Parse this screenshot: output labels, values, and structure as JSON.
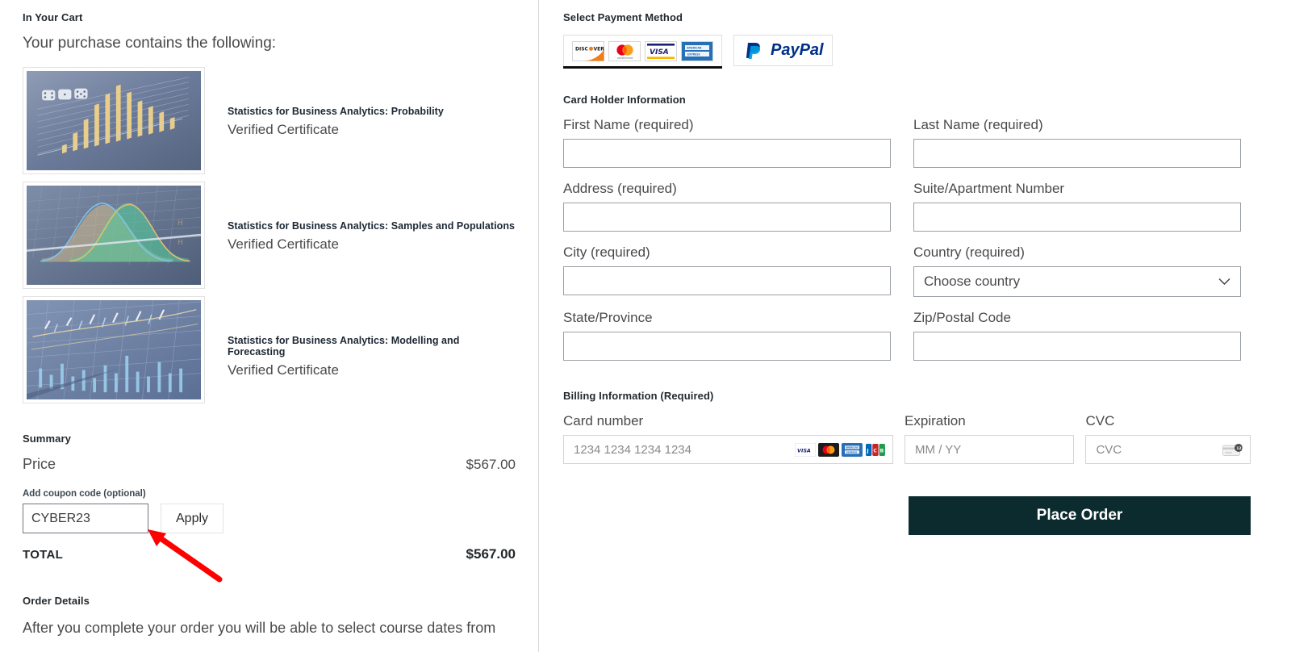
{
  "cart": {
    "heading": "In Your Cart",
    "lead": "Your purchase contains the following:",
    "items": [
      {
        "title": "Statistics for Business Analytics: Probability",
        "subtitle": "Verified Certificate",
        "thumb": "bar-chart-dice-image"
      },
      {
        "title": "Statistics for Business Analytics: Samples and Populations",
        "subtitle": "Verified Certificate",
        "thumb": "bell-curves-image"
      },
      {
        "title": "Statistics for Business Analytics: Modelling and Forecasting",
        "subtitle": "Verified Certificate",
        "thumb": "financial-chart-image"
      }
    ]
  },
  "summary": {
    "heading": "Summary",
    "price_label": "Price",
    "price_value": "$567.00",
    "coupon_label": "Add coupon code (optional)",
    "coupon_value": "CYBER23",
    "coupon_placeholder": "",
    "apply_label": "Apply",
    "total_label": "TOTAL",
    "total_value": "$567.00"
  },
  "order_details": {
    "heading": "Order Details",
    "body": "After you complete your order you will be able to select course dates from"
  },
  "payment": {
    "heading": "Select Payment Method",
    "methods": [
      {
        "name": "credit-card",
        "selected": true,
        "brands": [
          "DISCOVER",
          "mastercard",
          "VISA",
          "AMERICAN EXPRESS"
        ]
      },
      {
        "name": "paypal",
        "selected": false,
        "label": "PayPal"
      }
    ]
  },
  "card_holder": {
    "heading": "Card Holder Information",
    "fields": [
      {
        "label": "First Name (required)",
        "value": "",
        "name": "first-name"
      },
      {
        "label": "Last Name (required)",
        "value": "",
        "name": "last-name"
      },
      {
        "label": "Address (required)",
        "value": "",
        "name": "address"
      },
      {
        "label": "Suite/Apartment Number",
        "value": "",
        "name": "suite"
      },
      {
        "label": "City (required)",
        "value": "",
        "name": "city"
      },
      {
        "label": "Country (required)",
        "value": "Choose country",
        "name": "country"
      },
      {
        "label": "State/Province",
        "value": "",
        "name": "state"
      },
      {
        "label": "Zip/Postal Code",
        "value": "",
        "name": "zip"
      }
    ]
  },
  "billing": {
    "heading": "Billing Information (Required)",
    "card_number_label": "Card number",
    "card_number_placeholder": "1234 1234 1234 1234",
    "expiration_label": "Expiration",
    "expiration_placeholder": "MM / YY",
    "cvc_label": "CVC",
    "cvc_placeholder": "CVC",
    "accepted_brands": [
      "VISA",
      "mastercard",
      "AMEX",
      "JCB"
    ]
  },
  "actions": {
    "place_order_label": "Place Order"
  },
  "colors": {
    "place_order_bg": "#0b2b2e",
    "annotation_arrow": "#ff0000",
    "text_primary": "#4a4a4a",
    "heading": "#24292e"
  }
}
